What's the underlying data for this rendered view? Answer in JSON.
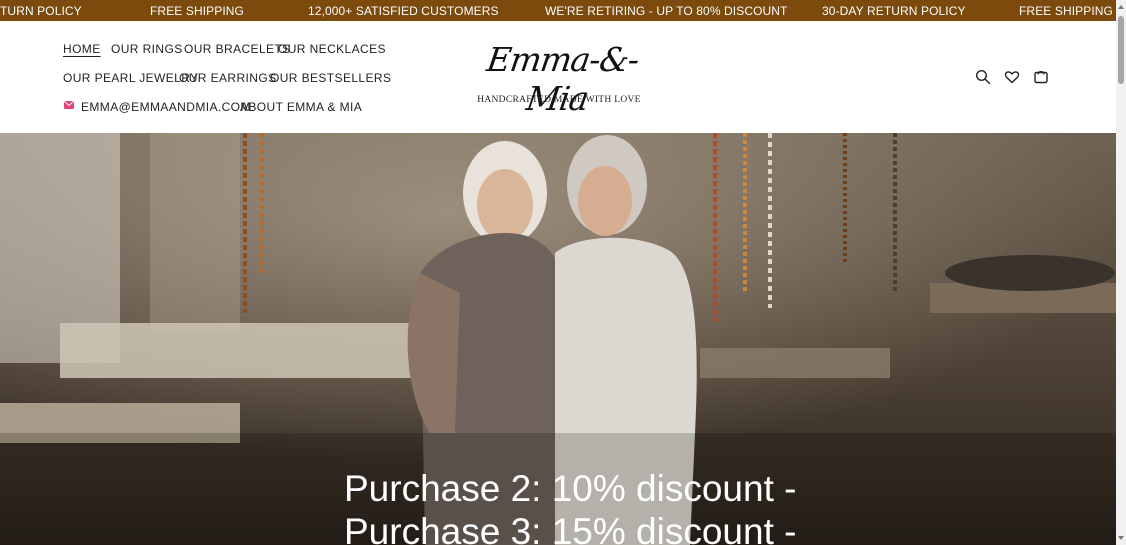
{
  "announcements": [
    "TURN POLICY",
    "FREE SHIPPING",
    "12,000+ SATISFIED CUSTOMERS",
    "WE'RE RETIRING - UP TO 80% DISCOUNT",
    "30-DAY RETURN POLICY",
    "FREE SHIPPING"
  ],
  "nav": {
    "home": "HOME",
    "rings": "OUR RINGS",
    "bracelets": "OUR BRACELETS",
    "necklaces": "OUR NECKLACES",
    "pearl": "OUR PEARL JEWELRY",
    "earrings": "OUR EARRINGS",
    "bestsellers": "OUR BESTSELLERS",
    "email": "EMMA@EMMAANDMIA.COM",
    "about": "ABOUT EMMA & MIA"
  },
  "logo": {
    "name": "Emma-&-Mia",
    "tagline": "HANDCRAFTED MADE WITH LOVE"
  },
  "header_icons": [
    "search-icon",
    "heart-icon",
    "cart-icon"
  ],
  "hero": {
    "line1": "Purchase 2: 10% discount -",
    "line2": "Purchase 3: 15% discount -"
  },
  "colors": {
    "announcement_bar": "#7b4a0c",
    "text": "#222222",
    "hero_text": "#ffffff"
  }
}
